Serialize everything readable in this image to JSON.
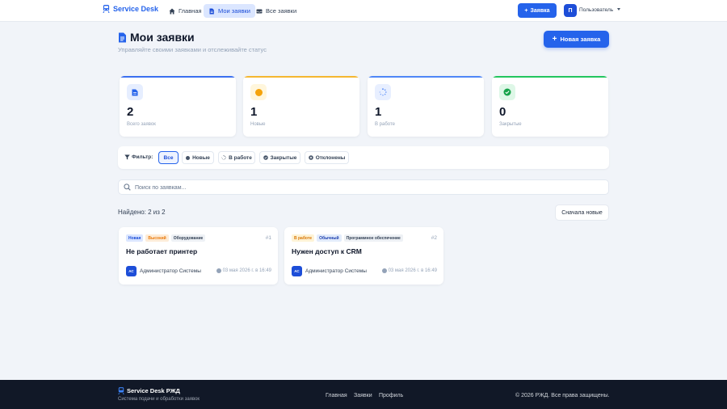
{
  "header": {
    "brand": "Service Desk",
    "nav": [
      {
        "label": "Главная"
      },
      {
        "label": "Мои заявки"
      },
      {
        "label": "Все заявки"
      }
    ],
    "new_button": "Заявка",
    "avatar_initial": "П",
    "user_name": "Пользователь"
  },
  "page": {
    "title": "Мои заявки",
    "subtitle": "Управляйте своими заявками и отслеживайте статус",
    "new_button": "Новая заявка"
  },
  "stats": [
    {
      "value": "2",
      "label": "Всего заявок",
      "color": "#3b6ff0"
    },
    {
      "value": "1",
      "label": "Новые",
      "color": "#f5b731"
    },
    {
      "value": "1",
      "label": "В работе",
      "color": "#4f86f7"
    },
    {
      "value": "0",
      "label": "Закрытые",
      "color": "#22c55e"
    }
  ],
  "filter": {
    "label": "Фильтр:",
    "chips": [
      {
        "label": "Все"
      },
      {
        "label": "Новые"
      },
      {
        "label": "В работе"
      },
      {
        "label": "Закрытые"
      },
      {
        "label": "Отклонены"
      }
    ]
  },
  "search": {
    "placeholder": "Поиск по заявкам...",
    "value": ""
  },
  "results": {
    "found": "Найдено: 2 из 2",
    "sort": "Сначала новые"
  },
  "tickets": [
    {
      "number": "#1",
      "title": "Не работает принтер",
      "tags": [
        "Новая",
        "Высокий",
        "Оборудование"
      ],
      "author_initials": "АС",
      "author": "Администратор Системы",
      "date": "03 мая 2026 г. в 16:49"
    },
    {
      "number": "#2",
      "title": "Нужен доступ к CRM",
      "tags": [
        "В работе",
        "Обычный",
        "Программное обеспечение"
      ],
      "author_initials": "АС",
      "author": "Администратор Системы",
      "date": "03 мая 2026 г. в 16:49"
    }
  ],
  "footer": {
    "brand": "Service Desk РЖД",
    "subtitle": "Система подачи и обработки заявок",
    "links": [
      "Главная",
      "Заявки",
      "Профиль"
    ],
    "copyright": "© 2026 РЖД. Все права защищены."
  }
}
